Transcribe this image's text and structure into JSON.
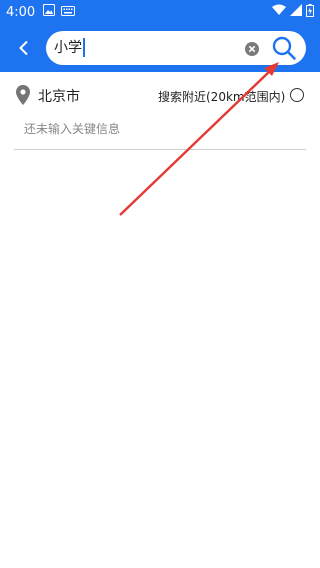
{
  "status_bar": {
    "time": "4:00",
    "icons": [
      "image-icon",
      "keyboard-icon",
      "wifi-icon",
      "signal-icon",
      "battery-icon"
    ]
  },
  "app_bar": {
    "background_color": "#1e74f0",
    "back_icon": "chevron-left-icon",
    "search": {
      "value": "小学",
      "clear_icon": "clear-icon",
      "search_icon": "search-icon"
    }
  },
  "location": {
    "pin_icon": "location-pin-icon",
    "city": "北京市",
    "nearby_label": "搜索附近(20km范围内)",
    "nearby_selected": false
  },
  "hint": "还未输入关键信息",
  "annotation": {
    "arrow_color": "#e53935",
    "arrow_icon": "pointer-arrow"
  }
}
